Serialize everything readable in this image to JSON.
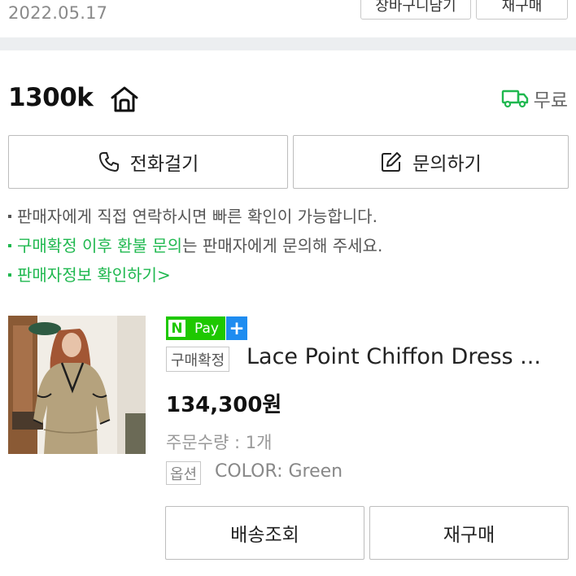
{
  "order": {
    "date": "2022.05.17",
    "top_buttons": [
      "장바구니담기",
      "재구매"
    ]
  },
  "seller": {
    "name": "1300k",
    "store_icon": "store-home-icon",
    "delivery_icon": "truck-icon",
    "delivery_text": "무료"
  },
  "actions": {
    "call_label": "전화걸기",
    "call_icon": "phone-icon",
    "inquiry_label": "문의하기",
    "inquiry_icon": "edit-icon"
  },
  "notices": {
    "line1": "판매자에게 직접 연락하시면 빠른 확인이 가능합니다.",
    "line2_link": "구매확정 이후 환불 문의",
    "line2_rest": "는 판매자에게 문의해 주세요.",
    "line3_link": "판매자정보 확인하기",
    "line3_chevron": ">"
  },
  "product": {
    "npay_n": "N",
    "npay_pay": "Pay",
    "npay_plus": "+",
    "status": "구매확정",
    "title": "Lace Point Chiffon Dress ...",
    "price": "134,300원",
    "quantity": "주문수량 : 1개",
    "option_label": "옵션",
    "option_value": "COLOR: Green"
  },
  "bottom_buttons": {
    "track": "배송조회",
    "rebuy": "재구매"
  },
  "colors": {
    "accent_green": "#1fb84f",
    "npay_green": "#1ec800",
    "npay_blue": "#1e8cf0",
    "divider": "#eceef0"
  }
}
